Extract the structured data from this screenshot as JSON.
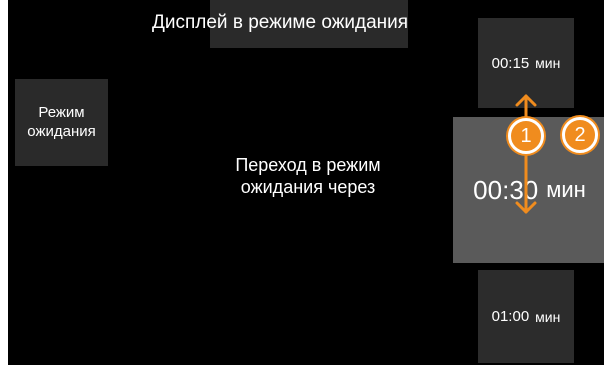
{
  "screen": {
    "title": "Дисплей в режиме ожидания",
    "standby_button": {
      "line1": "Режим",
      "line2": "ожидания"
    },
    "transition_label": {
      "line1": "Переход в режим",
      "line2": "ожидания через"
    },
    "timeout_options": [
      {
        "value": "00:15",
        "unit": "мин",
        "selected": false
      },
      {
        "value": "00:30",
        "unit": "мин",
        "selected": true
      },
      {
        "value": "01:00",
        "unit": "мин",
        "selected": false
      }
    ]
  },
  "annotations": {
    "markers": [
      "1",
      "2"
    ],
    "accent_color": "#f08c1e",
    "icons": [
      "up-arrow-icon",
      "down-arrow-icon"
    ]
  }
}
